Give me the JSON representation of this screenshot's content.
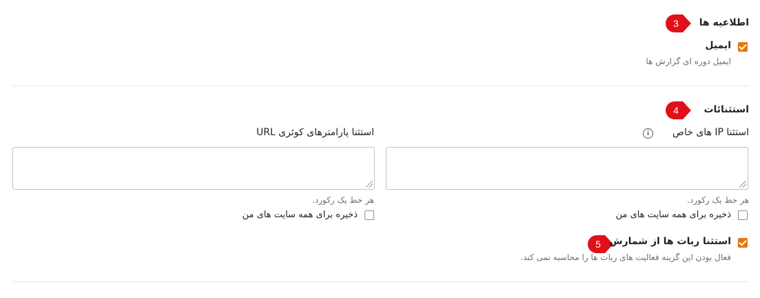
{
  "notifications": {
    "title": "اطلاعیه ها",
    "badge": "3",
    "email": {
      "label": "ایمیل",
      "checked": true,
      "description": "ایمیل دوره ای گزارش ها"
    }
  },
  "exclusions": {
    "title": "استثنائات",
    "badge": "4",
    "ip": {
      "label": "استثنا IP های خاص",
      "value": "",
      "hint": "هر خط یک رکورد.",
      "save_all_label": "ذخیره برای همه سایت های من",
      "save_all_checked": false
    },
    "url": {
      "label": "استثنا پارامترهای کوئری URL",
      "value": "",
      "hint": "هر خط یک رکورد.",
      "save_all_label": "ذخیره برای همه سایت های من",
      "save_all_checked": false
    },
    "bots": {
      "badge": "5",
      "label": "استثنا ربات ها از شمارش",
      "checked": true,
      "description": "فعال بودن این گزینه فعالیت های ربات ها را محاسبه نمی کند."
    }
  },
  "colors": {
    "accent": "#e5780b",
    "badge": "#e0101a"
  }
}
